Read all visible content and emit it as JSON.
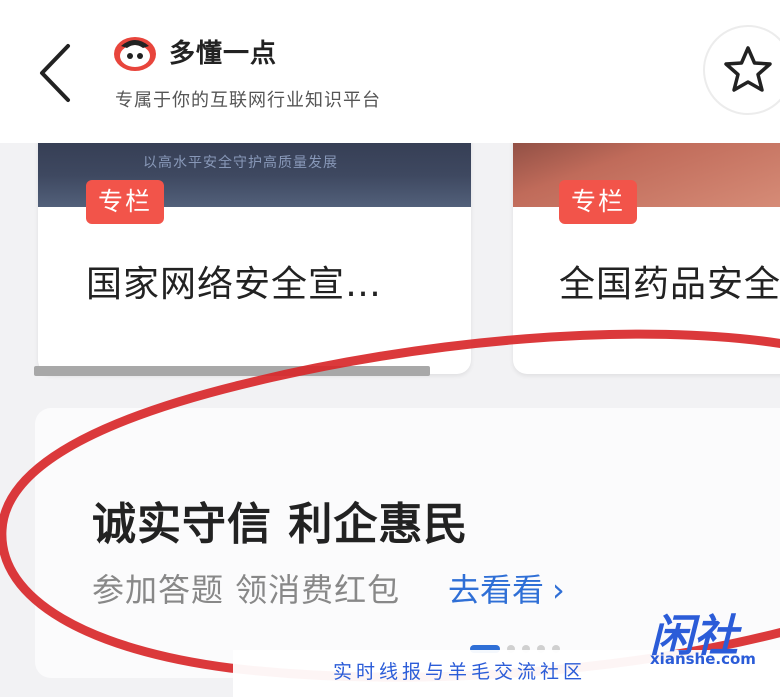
{
  "header": {
    "back_icon": "chevron-left-icon",
    "app_name": "多懂一点",
    "app_slogan": "专属于你的互联网行业知识平台",
    "favorite_icon": "star-outline-icon"
  },
  "cards": [
    {
      "image_text": "以高水平安全守护高质量发展",
      "tag": "专栏",
      "title": "国家网络安全宣…"
    },
    {
      "tag": "专栏",
      "title": "全国药品安全"
    }
  ],
  "banner": {
    "title": "诚实守信 利企惠民",
    "subtitle": "参加答题 领消费红包",
    "link_label": "去看看",
    "link_chevron": "›",
    "active_slide": 1,
    "slide_count": 5
  },
  "watermark": {
    "slogan": "实时线报与羊毛交流社区",
    "logo_text": "闲社",
    "domain": "xianshe.com"
  },
  "colors": {
    "tag_red": "#f2544a",
    "link_blue": "#2f6fd6",
    "annotation_red": "#d8282a",
    "watermark_blue": "#2b5cd8"
  }
}
